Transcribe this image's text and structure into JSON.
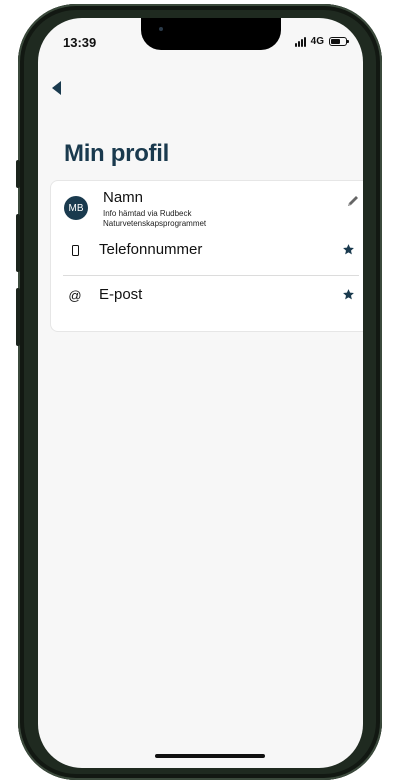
{
  "status_bar": {
    "time": "13:39",
    "network": "4G"
  },
  "header": {
    "back_icon": "chevron-left-icon",
    "title": "Min profil"
  },
  "profile": {
    "avatar_initials": "MB",
    "name_label": "Namn",
    "info_line1": "Info hämtad via Rudbeck",
    "info_line2": "Naturvetenskapsprogrammet",
    "edit_icon": "pencil-icon"
  },
  "fields": [
    {
      "icon": "smartphone-icon",
      "label": "Telefonnummer",
      "action_icon": "star-icon"
    },
    {
      "icon": "at-sign-icon",
      "icon_glyph": "@",
      "label": "E-post",
      "action_icon": "star-icon"
    }
  ],
  "colors": {
    "accent": "#1a3a4e",
    "background": "#f7f7f7",
    "card": "#ffffff"
  }
}
